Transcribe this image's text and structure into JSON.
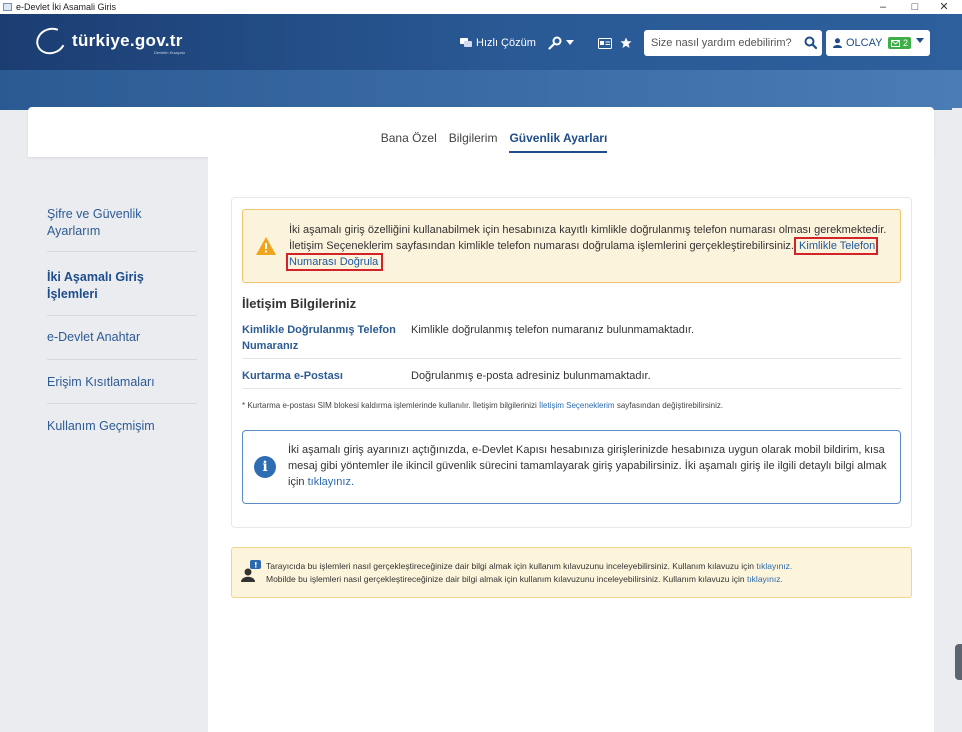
{
  "window": {
    "title": "e-Devlet İki Asamali Giris",
    "minimize": "–",
    "maximize": "□",
    "close": "✕"
  },
  "header": {
    "logo_text": "türkiye.gov.tr",
    "logo_sub": "Devletin Kısayolu",
    "quick_solution": "Hızlı Çözüm",
    "search_placeholder": "Size nasıl yardım edebilirim?",
    "user_name": "OLCAY",
    "mail_count": "2"
  },
  "tabs": [
    {
      "label": "Bana Özel",
      "active": false
    },
    {
      "label": "Bilgilerim",
      "active": false
    },
    {
      "label": "Güvenlik Ayarları",
      "active": true
    }
  ],
  "sidebar": {
    "items": [
      {
        "label": "Şifre ve Güvenlik Ayarlarım",
        "active": false
      },
      {
        "label": "İki Aşamalı Giriş İşlemleri",
        "active": true
      },
      {
        "label": "e-Devlet Anahtar",
        "active": false
      },
      {
        "label": "Erişim Kısıtlamaları",
        "active": false
      },
      {
        "label": "Kullanım Geçmişim",
        "active": false
      }
    ]
  },
  "warning": {
    "text": "İki aşamalı giriş özelliğini kullanabilmek için hesabınıza kayıtlı kimlikle doğrulanmış telefon numarası olması gerekmektedir. İletişim Seçeneklerim sayfasından kimlikle telefon numarası doğrulama işlemlerini gerçekleştirebilirsiniz.",
    "link": "Kimlikle Telefon Numarası Doğrula"
  },
  "contact": {
    "title": "İletişim Bilgileriniz",
    "rows": [
      {
        "label": "Kimlikle Doğrulanmış Telefon Numaranız",
        "value": "Kimlikle doğrulanmış telefon numaranız bulunmamaktadır."
      },
      {
        "label": "Kurtarma e-Postası",
        "value": "Doğrulanmış e-posta adresiniz bulunmamaktadır."
      }
    ],
    "footnote_pre": "* Kurtarma e-postası SIM blokesi kaldırma işlemlerinde kullanılır. İletişim bilgilerinizi",
    "footnote_link": "İletişim Seçeneklerim",
    "footnote_post": "sayfasından değiştirebilirsiniz."
  },
  "info": {
    "text": "İki aşamalı giriş ayarınızı açtığınızda, e-Devlet Kapısı hesabınıza girişlerinizde hesabınıza uygun olarak mobil bildirim, kısa mesaj gibi yöntemler ile ikincil güvenlik sürecini tamamlayarak giriş yapabilirsiniz. İki aşamalı giriş ile ilgili detaylı bilgi almak için",
    "link": "tıklayınız."
  },
  "guide": {
    "line1": "Tarayıcıda bu işlemleri nasıl gerçekleştireceğinize dair bilgi almak için kullanım kılavuzunu inceleyebilirsiniz. Kullanım kılavuzu için",
    "line2": "Mobilde bu işlemleri nasıl gerçekleştireceğinize dair bilgi almak için kullanım kılavuzunu inceleyebilirsiniz. Kullanım kılavuzu için",
    "link": "tıklayınız."
  },
  "colors": {
    "header": "#1b3d72",
    "accent": "#1e4d8c",
    "warning_bg": "#fcf3dc",
    "highlight_box": "#d3222a",
    "mail_badge": "#3fae49"
  }
}
